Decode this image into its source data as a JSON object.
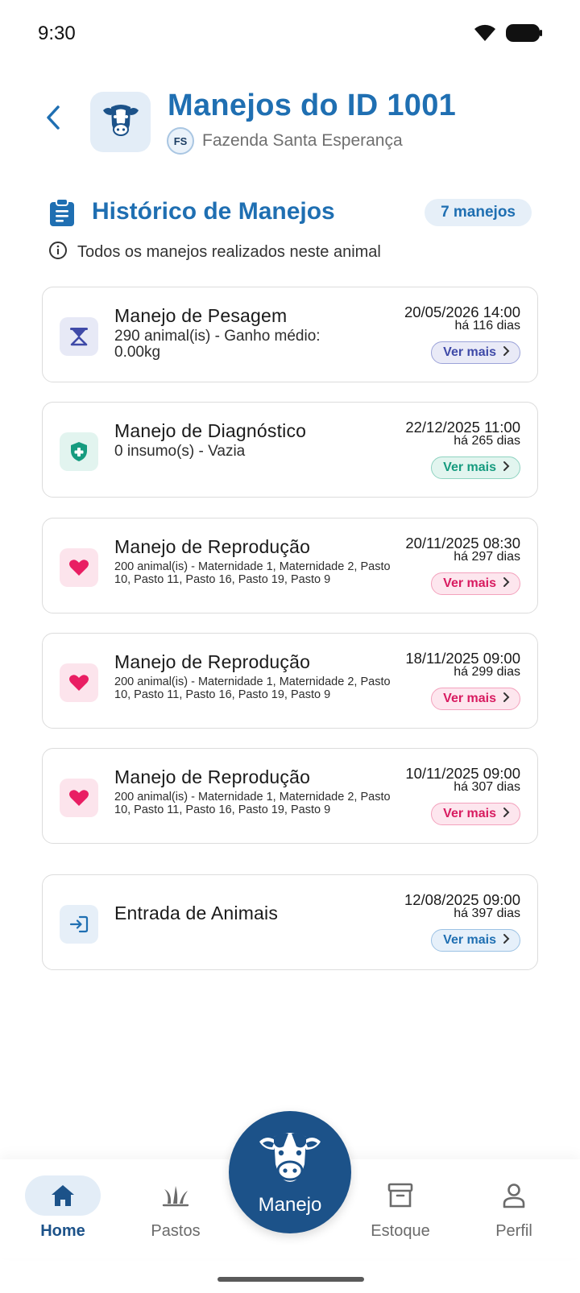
{
  "status_bar": {
    "time": "9:30"
  },
  "header": {
    "title": "Manejos do ID 1001",
    "farm_initials": "FS",
    "farm_name": "Fazenda Santa Esperança"
  },
  "section": {
    "title": "Histórico de Manejos",
    "count": "7 manejos",
    "subtitle": "Todos os manejos realizados neste animal"
  },
  "colors": {
    "primary": "#1f6fb2",
    "pesagem": "#3f4aa8",
    "diagnostico": "#169b7f",
    "reproducao": "#d81b60",
    "entrada": "#1f6fb2"
  },
  "cards": [
    {
      "type": "pesagem",
      "icon": "scale-icon",
      "title": "Manejo de Pesagem",
      "description": "290 animal(is) - Ganho médio: 0.00kg",
      "date": "20/05/2026 14:00",
      "ago": "há 116 dias",
      "action": "Ver mais"
    },
    {
      "type": "diagnostico",
      "icon": "shield-plus-icon",
      "title": "Manejo de Diagnóstico",
      "description": "0 insumo(s) - Vazia",
      "date": "22/12/2025 11:00",
      "ago": "há 265 dias",
      "action": "Ver mais"
    },
    {
      "type": "reproducao",
      "icon": "heart-icon",
      "title": "Manejo de Reprodução",
      "description": "200 animal(is) - Maternidade 1, Maternidade 2, Pasto 10, Pasto 11, Pasto 16, Pasto 19, Pasto 9",
      "date": "20/11/2025 08:30",
      "ago": "há 297 dias",
      "action": "Ver mais"
    },
    {
      "type": "reproducao",
      "icon": "heart-icon",
      "title": "Manejo de Reprodução",
      "description": "200 animal(is) - Maternidade 1, Maternidade 2, Pasto 10, Pasto 11, Pasto 16, Pasto 19, Pasto 9",
      "date": "18/11/2025 09:00",
      "ago": "há 299 dias",
      "action": "Ver mais"
    },
    {
      "type": "reproducao",
      "icon": "heart-icon",
      "title": "Manejo de Reprodução",
      "description": "200 animal(is) - Maternidade 1, Maternidade 2, Pasto 10, Pasto 11, Pasto 16, Pasto 19, Pasto 9",
      "date": "10/11/2025 09:00",
      "ago": "há 307 dias",
      "action": "Ver mais"
    },
    {
      "type": "entrada",
      "icon": "login-arrow-icon",
      "title": "Entrada de Animais",
      "description": "",
      "date": "12/08/2025 09:00",
      "ago": "há 397 dias",
      "action": "Ver mais"
    }
  ],
  "bottom_nav": {
    "items": [
      {
        "label": "Home",
        "icon": "home-icon",
        "active": true
      },
      {
        "label": "Pastos",
        "icon": "grass-icon",
        "active": false
      },
      {
        "label": "Manejo",
        "icon": "cow-icon",
        "active": false
      },
      {
        "label": "Estoque",
        "icon": "archive-box-icon",
        "active": false
      },
      {
        "label": "Perfil",
        "icon": "person-icon",
        "active": false
      }
    ]
  }
}
